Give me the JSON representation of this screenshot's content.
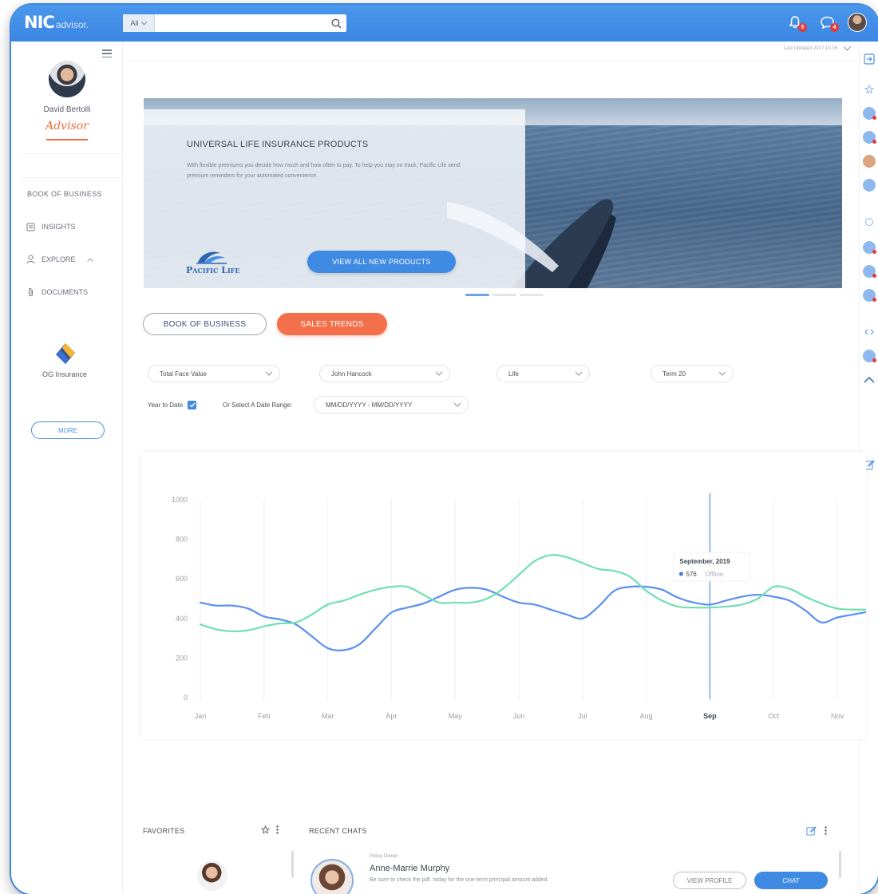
{
  "app": {
    "logo_main": "NIC",
    "logo_sub": "advisor."
  },
  "header": {
    "search_scope": "All",
    "search_placeholder": "",
    "notif_badge": "5",
    "chat_badge": "4"
  },
  "sidebar": {
    "profile_name": "David Bertolli",
    "signature": "Advisor",
    "section_heading": "BOOK OF BUSINESS",
    "items": [
      {
        "label": "INSIGHTS",
        "icon": "document-icon"
      },
      {
        "label": "EXPLORE",
        "icon": "person-icon"
      },
      {
        "label": "DOCUMENTS",
        "icon": "paperclip-icon"
      }
    ],
    "company_name": "OG Insurance",
    "more_label": "MORE"
  },
  "main": {
    "last_updated": "Last Updated 2017.10.16",
    "banner": {
      "title": "UNIVERSAL LIFE INSURANCE PRODUCTS",
      "text": "With flexible premiums you decide how much and how often to pay. To help you stay on track, Pacific Life send premium reminders for your automated convenience.",
      "brand": "Pacific Life",
      "button_label": "VIEW ALL NEW PRODUCTS"
    },
    "tabs": {
      "book": "BOOK OF BUSINESS",
      "sales": "SALES TRENDS"
    },
    "filters": {
      "metric": "Total Face Value",
      "carrier": "John Hancock",
      "line": "Life",
      "product": "Term 20",
      "ytd_label": "Year to Date",
      "range_label": "Or Select A Date Range:",
      "range_value": "MM/DD/YYYY - MM/DD/YYYY"
    },
    "favorites": {
      "title": "FAVORITES"
    },
    "recent_chats": {
      "title": "RECENT CHATS",
      "role": "Policy Owner",
      "name": "Anne-Marrie Murphy",
      "message": "Be sure to check the pdf. today for the one term principal amount added",
      "view_profile_label": "VIEW PROFILE",
      "chat_label": "CHAT"
    }
  },
  "colors": {
    "accent": "#3f8ae2",
    "orange": "#f4704a",
    "series_blue": "#5b8ff0",
    "series_green": "#6fe0b0"
  },
  "chart_data": {
    "type": "line",
    "categories": [
      "Jan",
      "Feb",
      "Mar",
      "Apr",
      "May",
      "Jun",
      "Jul",
      "Aug",
      "Sep",
      "Oct",
      "Nov"
    ],
    "x": [
      0,
      0.25,
      0.5,
      0.75,
      1,
      1.25,
      1.5,
      1.75,
      2,
      2.25,
      2.5,
      2.75,
      3,
      3.25,
      3.5,
      3.75,
      4,
      4.25,
      4.5,
      4.75,
      5,
      5.25,
      5.5,
      5.75,
      6,
      6.25,
      6.5,
      6.75,
      7,
      7.25,
      7.5,
      7.75,
      8,
      8.25,
      8.5,
      8.75,
      9,
      9.25,
      9.5,
      9.75,
      10,
      10.25,
      10.5
    ],
    "series": [
      {
        "values": [
          480,
          465,
          465,
          450,
          410,
          395,
          370,
          310,
          250,
          240,
          270,
          350,
          430,
          455,
          475,
          510,
          545,
          555,
          545,
          510,
          480,
          470,
          445,
          420,
          400,
          460,
          540,
          560,
          560,
          545,
          505,
          480,
          470,
          490,
          510,
          520,
          510,
          490,
          440,
          380,
          405,
          420,
          435
        ]
      },
      {
        "values": [
          370,
          345,
          335,
          340,
          360,
          375,
          380,
          420,
          470,
          490,
          520,
          545,
          560,
          560,
          520,
          480,
          480,
          480,
          500,
          550,
          620,
          690,
          720,
          710,
          680,
          650,
          640,
          610,
          540,
          490,
          460,
          455,
          455,
          460,
          470,
          500,
          560,
          550,
          510,
          475,
          450,
          445,
          445
        ]
      }
    ],
    "ylim": [
      0,
      1000
    ],
    "yticks": [
      0,
      200,
      400,
      600,
      800,
      1000
    ],
    "highlight": {
      "category": "Sep",
      "title": "September, 2019",
      "value": "576",
      "label": "Offline"
    },
    "grid": "vertical"
  }
}
